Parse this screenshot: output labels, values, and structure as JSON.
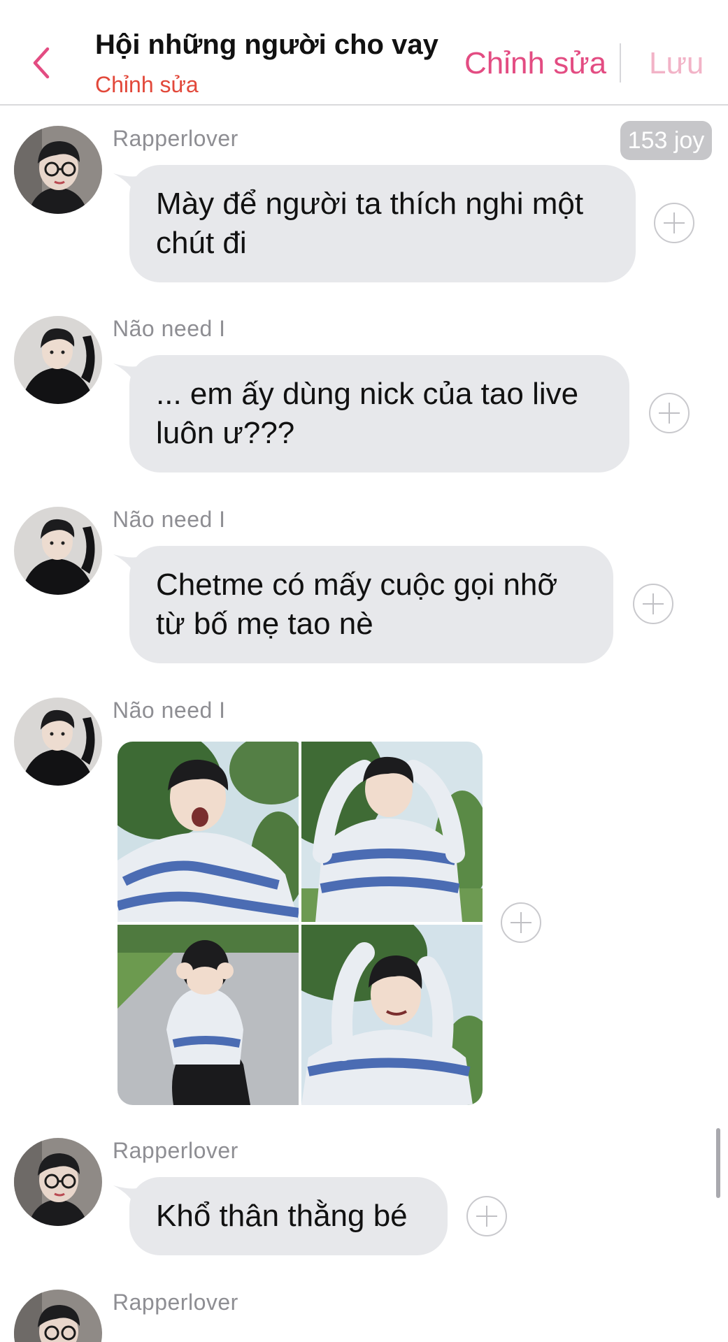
{
  "header": {
    "title": "Hội những người cho vay",
    "subtitle": "Chỉnh sửa",
    "edit_label": "Chỉnh sửa",
    "save_label": "Lưu",
    "back_icon": "chevron-left-icon",
    "accent_color": "#e34c82",
    "subtitle_color": "#e2483a"
  },
  "badge": {
    "text": "153 joy"
  },
  "messages": [
    {
      "sender": "Rapperlover",
      "type": "text",
      "lines": [
        "Mày để người ta thích nghi một",
        "chút đi"
      ]
    },
    {
      "sender": "Não need I",
      "type": "text",
      "lines": [
        "... em ấy dùng nick của tao live",
        "luôn ư???"
      ]
    },
    {
      "sender": "Não need I",
      "type": "text",
      "lines": [
        "Chetme có mấy cuộc gọi nhỡ",
        "từ bố mẹ tao nè"
      ]
    },
    {
      "sender": "Não need I",
      "type": "image"
    },
    {
      "sender": "Rapperlover",
      "type": "text",
      "lines": [
        "Khổ thân thằng bé"
      ]
    },
    {
      "sender": "Rapperlover",
      "type": "text",
      "lines": []
    }
  ],
  "colors": {
    "bubble": "#e7e8eb",
    "sender": "#8e8e93",
    "badge": "#c6c6c9"
  }
}
